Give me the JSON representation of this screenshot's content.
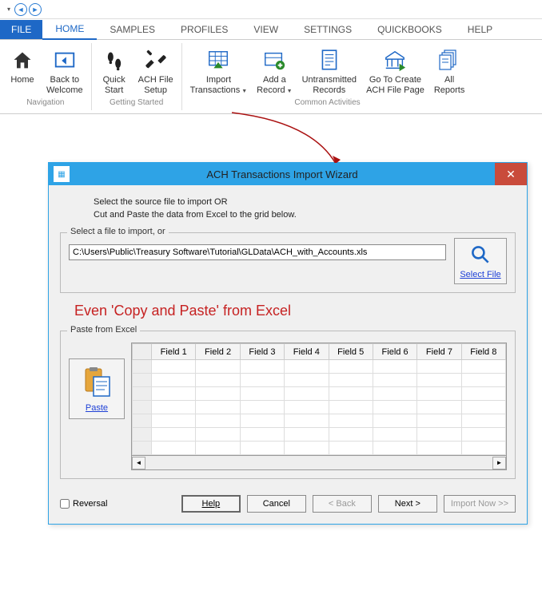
{
  "tabs": {
    "file": "FILE",
    "list": [
      "HOME",
      "SAMPLES",
      "PROFILES",
      "VIEW",
      "SETTINGS",
      "QUICKBOOKS",
      "HELP"
    ],
    "active": "HOME"
  },
  "ribbon": {
    "groups": [
      {
        "label": "Navigation",
        "buttons": [
          {
            "key": "home",
            "line1": "Home",
            "line2": "",
            "dropdown": false
          },
          {
            "key": "back",
            "line1": "Back to",
            "line2": "Welcome",
            "dropdown": false
          }
        ]
      },
      {
        "label": "Getting Started",
        "buttons": [
          {
            "key": "quickstart",
            "line1": "Quick",
            "line2": "Start",
            "dropdown": false
          },
          {
            "key": "achsetup",
            "line1": "ACH File",
            "line2": "Setup",
            "dropdown": false
          }
        ]
      },
      {
        "label": "Common Activities",
        "buttons": [
          {
            "key": "import",
            "line1": "Import",
            "line2": "Transactions",
            "dropdown": true
          },
          {
            "key": "addrec",
            "line1": "Add a",
            "line2": "Record",
            "dropdown": true
          },
          {
            "key": "untrans",
            "line1": "Untransmitted",
            "line2": "Records",
            "dropdown": false
          },
          {
            "key": "goto",
            "line1": "Go To Create",
            "line2": "ACH File Page",
            "dropdown": false
          },
          {
            "key": "reports",
            "line1": "All",
            "line2": "Reports",
            "dropdown": false
          }
        ]
      }
    ]
  },
  "wizard": {
    "title": "ACH Transactions Import Wizard",
    "instruction_l1": "Select the source file to import OR",
    "instruction_l2": "Cut and Paste the data from Excel to the grid below.",
    "select_legend": "Select a file to import, or",
    "file_path": "C:\\Users\\Public\\Treasury Software\\Tutorial\\GLData\\ACH_with_Accounts.xls",
    "select_file": "Select File",
    "callout": "Even 'Copy and Paste' from Excel",
    "paste_legend": "Paste from Excel",
    "paste_btn": "Paste",
    "grid_headers": [
      "Field 1",
      "Field 2",
      "Field 3",
      "Field 4",
      "Field 5",
      "Field 6",
      "Field 7",
      "Field 8"
    ],
    "reversal": "Reversal",
    "buttons": {
      "help": "Help",
      "cancel": "Cancel",
      "back": "< Back",
      "next": "Next >",
      "import": "Import Now >>"
    }
  }
}
